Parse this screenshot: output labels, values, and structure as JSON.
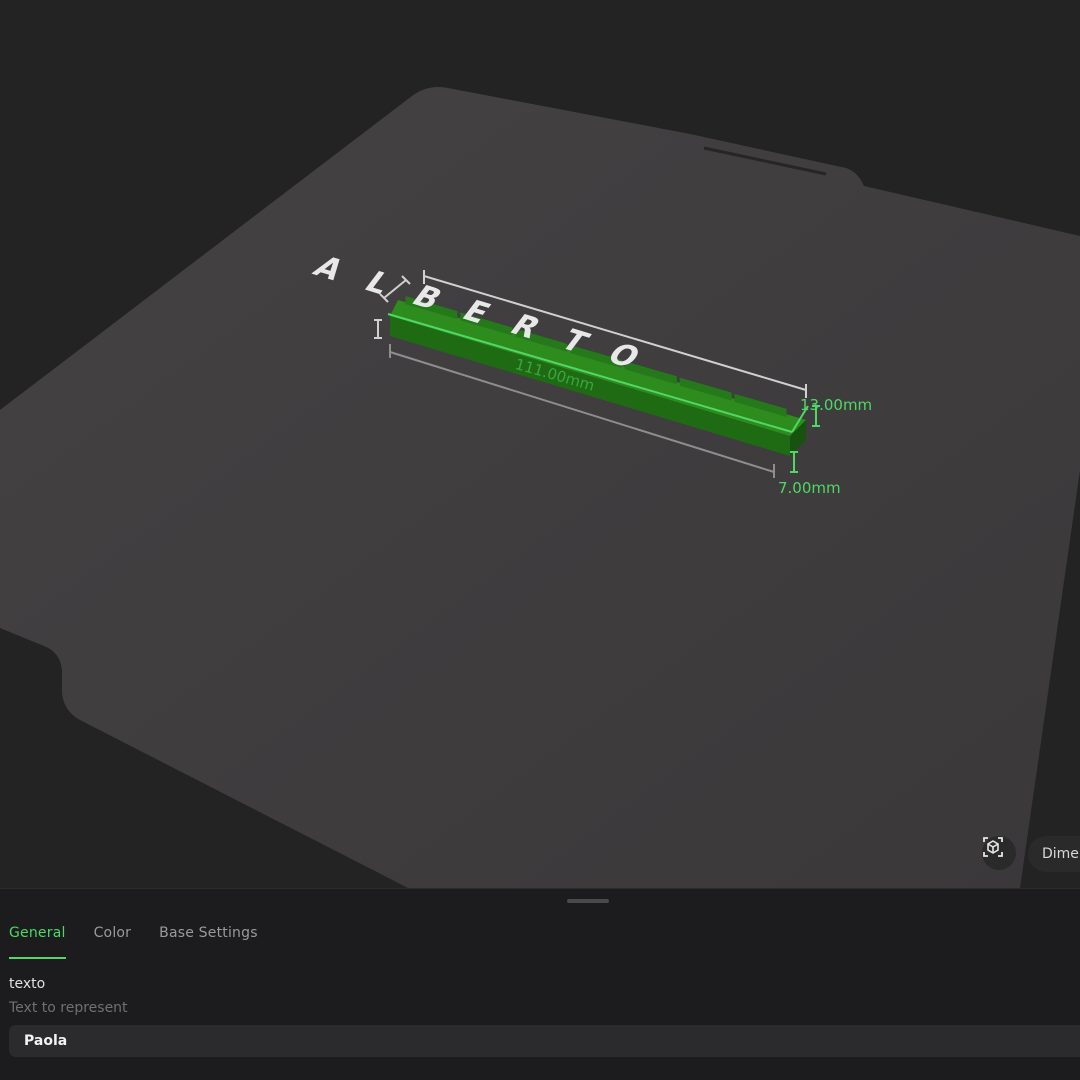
{
  "viewport": {
    "model_text": "ALBERTO",
    "dimensions": {
      "length": "111.00mm",
      "height": "13.00mm",
      "depth": "7.00mm"
    },
    "view_button_icon": "3d-view-icon",
    "dimensions_toggle_label": "Dimer"
  },
  "panel": {
    "tabs": [
      {
        "label": "General",
        "active": true
      },
      {
        "label": "Color",
        "active": false
      },
      {
        "label": "Base Settings",
        "active": false
      }
    ],
    "field": {
      "label": "texto",
      "help": "Text to represent",
      "value": "Paola"
    }
  },
  "colors": {
    "accent": "#4cd964",
    "model_green": "#2e8b1e",
    "bed": "#3d3b3c",
    "background": "#232323"
  }
}
